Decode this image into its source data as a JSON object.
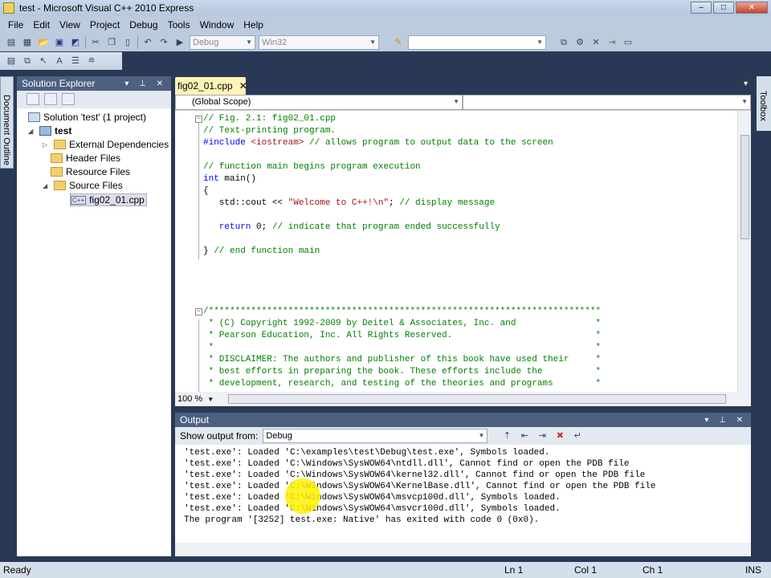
{
  "window": {
    "title": "test - Microsoft Visual C++ 2010 Express"
  },
  "menu": [
    "File",
    "Edit",
    "View",
    "Project",
    "Debug",
    "Tools",
    "Window",
    "Help"
  ],
  "toolbar": {
    "config": "Debug",
    "platform": "Win32",
    "find": ""
  },
  "side_tabs": {
    "left": "Document Outline",
    "right": "Toolbox"
  },
  "solution_explorer": {
    "title": "Solution Explorer",
    "items": [
      {
        "label": "Solution 'test' (1 project)"
      },
      {
        "label": "test"
      },
      {
        "label": "External Dependencies"
      },
      {
        "label": "Header Files"
      },
      {
        "label": "Resource Files"
      },
      {
        "label": "Source Files"
      },
      {
        "label": "fig02_01.cpp"
      }
    ]
  },
  "editor": {
    "tab": "fig02_01.cpp",
    "scope": "(Global Scope)",
    "zoom": "100 %",
    "lines": [
      [
        {
          "t": "// Fig. 2.1: fig02_01.cpp",
          "c": "c"
        }
      ],
      [
        {
          "t": "// Text-printing program.",
          "c": "c"
        }
      ],
      [
        {
          "t": "#include",
          "c": "k"
        },
        {
          "t": " <iostream> ",
          "c": "s"
        },
        {
          "t": "// allows program to output data to the screen",
          "c": "c"
        }
      ],
      [],
      [
        {
          "t": "// function main begins program execution",
          "c": "c"
        }
      ],
      [
        {
          "t": "int",
          "c": "k"
        },
        {
          "t": " main()",
          "c": "p"
        }
      ],
      [
        {
          "t": "{",
          "c": "p"
        }
      ],
      [
        {
          "t": "   std::cout << ",
          "c": "p"
        },
        {
          "t": "\"Welcome to C++!\\n\"",
          "c": "s"
        },
        {
          "t": "; ",
          "c": "p"
        },
        {
          "t": "// display message",
          "c": "c"
        }
      ],
      [],
      [
        {
          "t": "   return",
          "c": "k"
        },
        {
          "t": " 0; ",
          "c": "p"
        },
        {
          "t": "// indicate that program ended successfully",
          "c": "c"
        }
      ],
      [],
      [
        {
          "t": "} ",
          "c": "p"
        },
        {
          "t": "// end function main",
          "c": "c"
        }
      ],
      [],
      [],
      [],
      [],
      [
        {
          "t": "/**************************************************************************",
          "c": "c"
        }
      ],
      [
        {
          "t": " * (C) Copyright 1992-2009 by Deitel & Associates, Inc. and               *",
          "c": "c"
        }
      ],
      [
        {
          "t": " * Pearson Education, Inc. All Rights Reserved.                           *",
          "c": "c"
        }
      ],
      [
        {
          "t": " *                                                                        *",
          "c": "c"
        }
      ],
      [
        {
          "t": " * DISCLAIMER: The authors and publisher of this book have used their     *",
          "c": "c"
        }
      ],
      [
        {
          "t": " * best efforts in preparing the book. These efforts include the          *",
          "c": "c"
        }
      ],
      [
        {
          "t": " * development, research, and testing of the theories and programs        *",
          "c": "c"
        }
      ]
    ]
  },
  "output": {
    "title": "Output",
    "show_from_label": "Show output from:",
    "source": "Debug",
    "lines": [
      "'test.exe': Loaded 'C:\\examples\\test\\Debug\\test.exe', Symbols loaded.",
      "'test.exe': Loaded 'C:\\Windows\\SysWOW64\\ntdll.dll', Cannot find or open the PDB file",
      "'test.exe': Loaded 'C:\\Windows\\SysWOW64\\kernel32.dll', Cannot find or open the PDB file",
      "'test.exe': Loaded 'C:\\Windows\\SysWOW64\\KernelBase.dll', Cannot find or open the PDB file",
      "'test.exe': Loaded 'C:\\Windows\\SysWOW64\\msvcp100d.dll', Symbols loaded.",
      "'test.exe': Loaded 'C:\\Windows\\SysWOW64\\msvcr100d.dll', Symbols loaded.",
      "The program '[3252] test.exe: Native' has exited with code 0 (0x0)."
    ]
  },
  "status": {
    "text": "Ready",
    "ln": "Ln 1",
    "col": "Col 1",
    "ch": "Ch 1",
    "mode": "INS"
  }
}
